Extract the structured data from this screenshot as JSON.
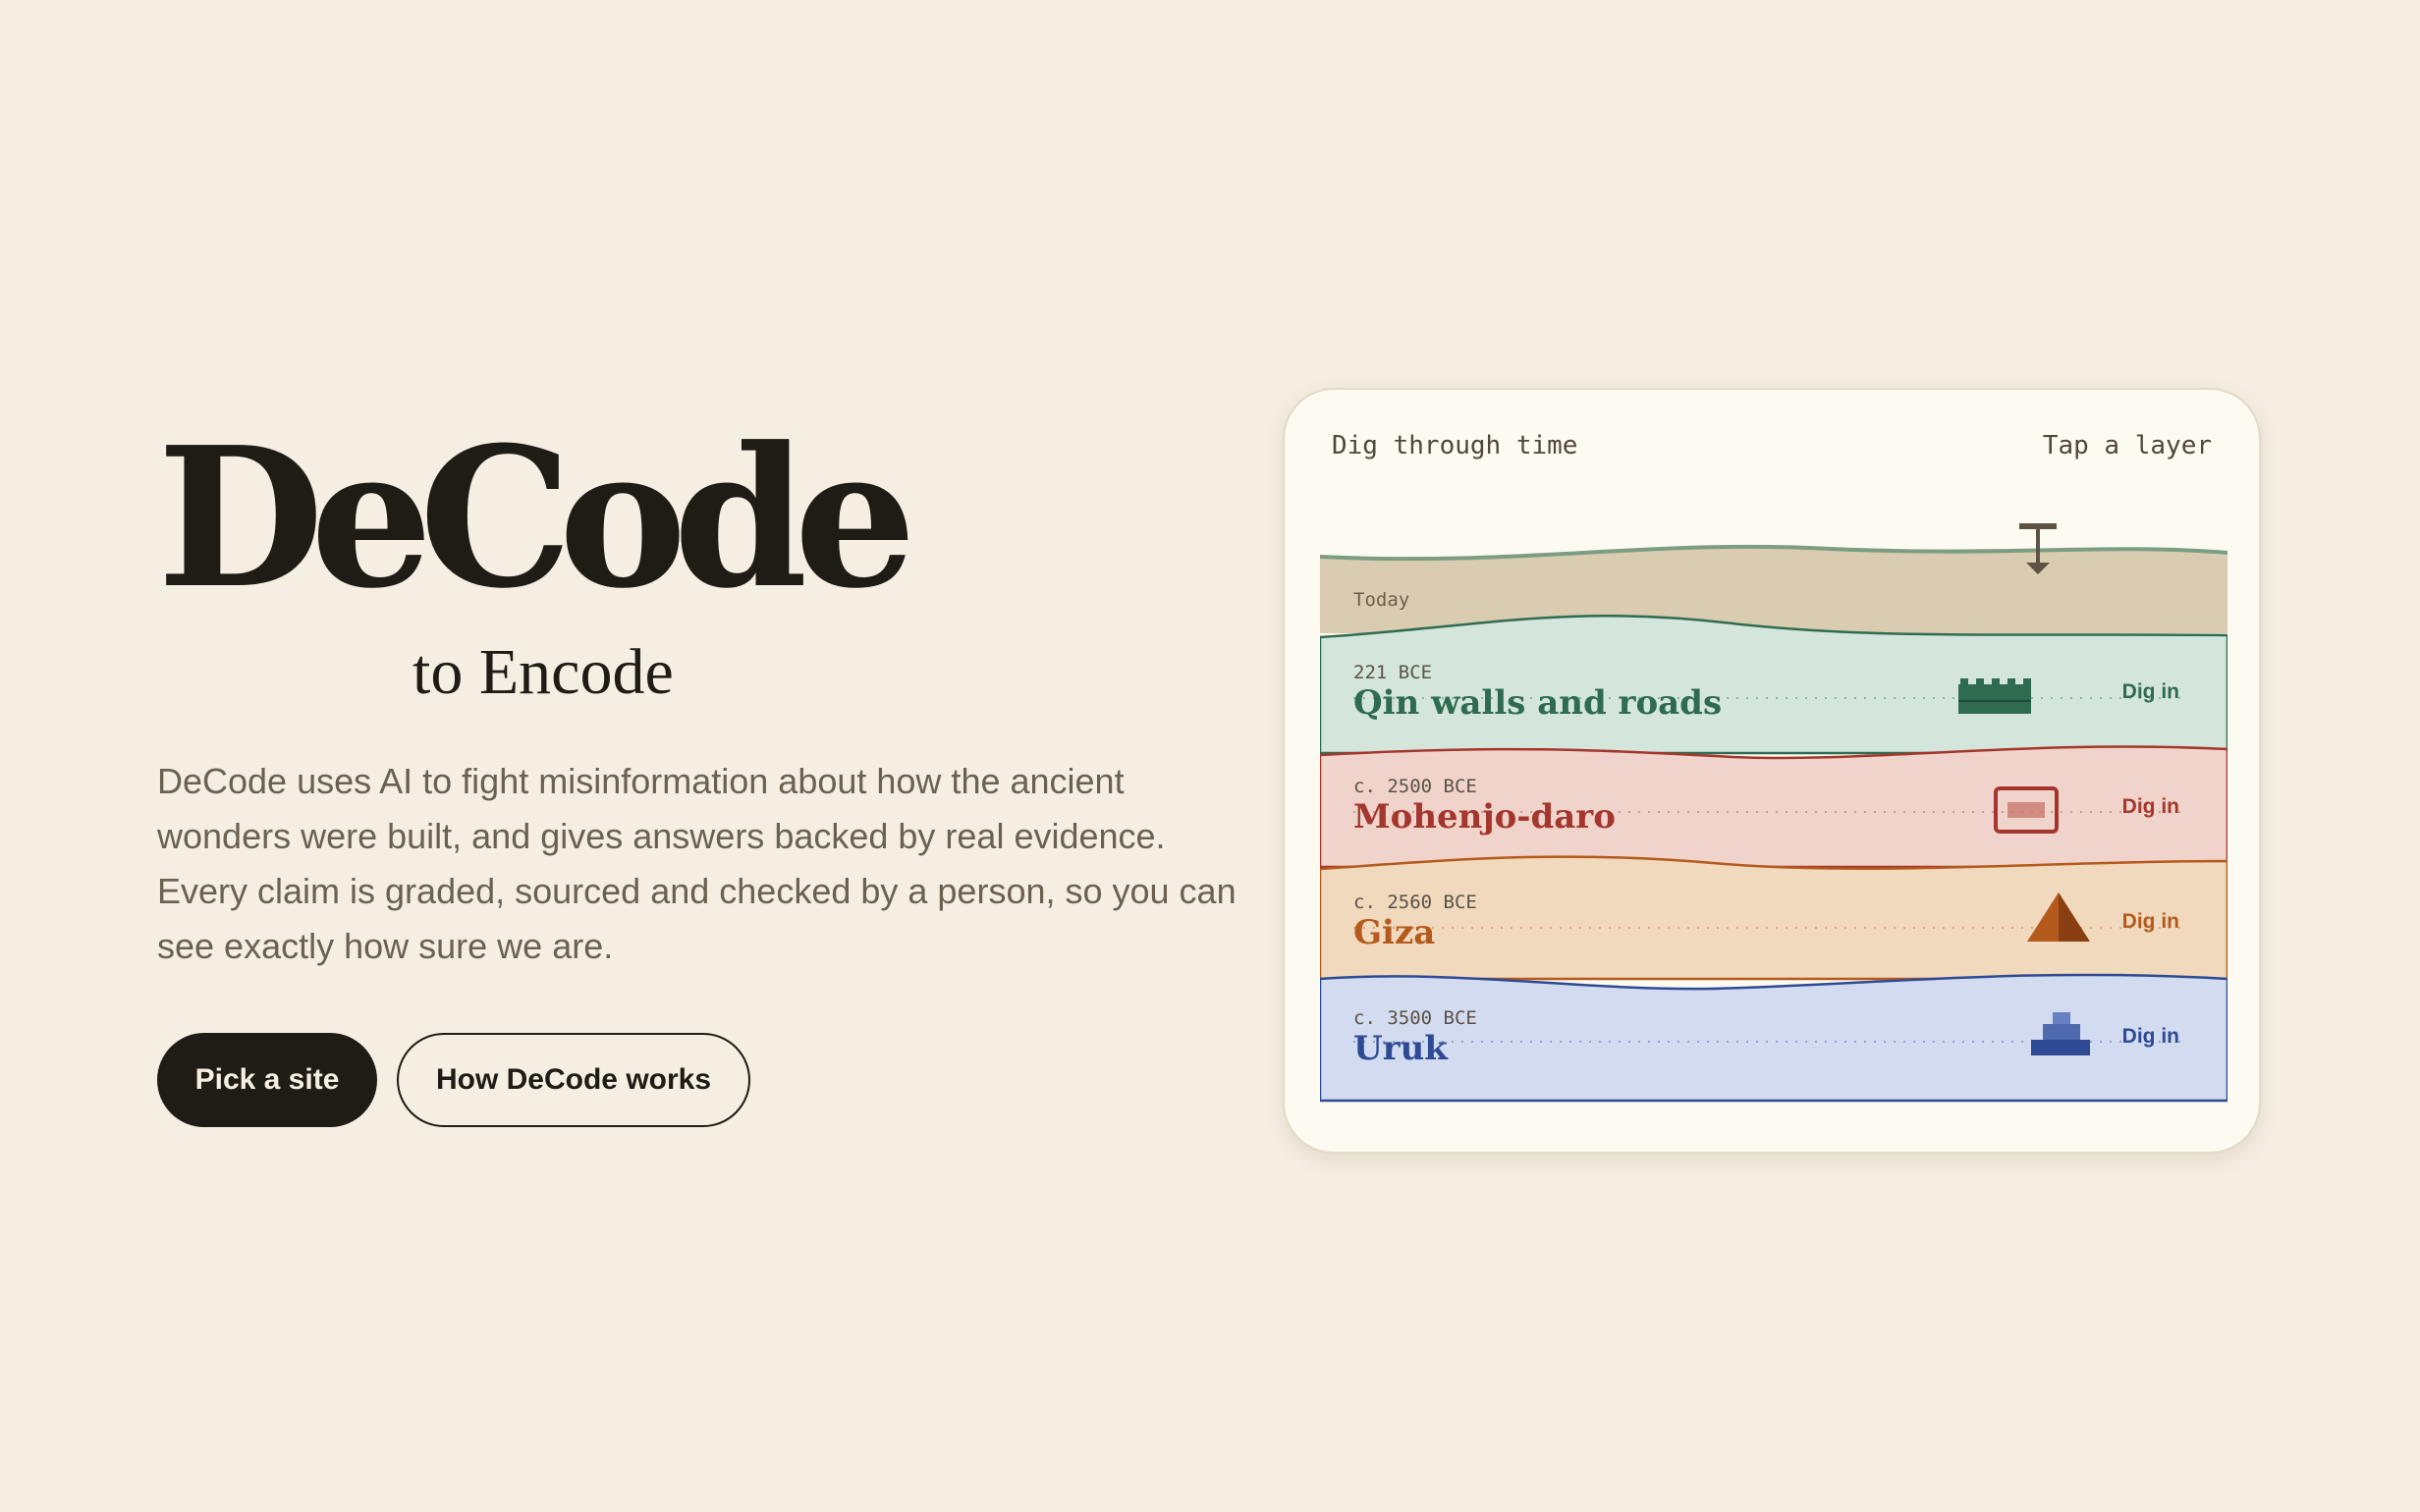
{
  "hero": {
    "title": "DeCode",
    "subtitle": "to Encode",
    "description": "DeCode uses AI to fight misinformation about how the ancient wonders were built, and gives answers backed by real evidence. Every claim is graded, sourced and checked by a person, so you can see exactly how sure we are.",
    "primary_button": "Pick a site",
    "secondary_button": "How DeCode works"
  },
  "card": {
    "header_left": "Dig through time",
    "header_right": "Tap a layer",
    "top_layer_label": "Today",
    "layers": [
      {
        "date": "221 BCE",
        "name": "Qin walls and roads",
        "action": "Dig in",
        "icon": "wall-icon",
        "color": "#2f6b50",
        "fill": "#d4e6dc"
      },
      {
        "date": "c. 2500 BCE",
        "name": "Mohenjo-daro",
        "action": "Dig in",
        "icon": "brick-grid-icon",
        "color": "#a3372d",
        "fill": "#f0d3cb"
      },
      {
        "date": "c. 2560 BCE",
        "name": "Giza",
        "action": "Dig in",
        "icon": "pyramid-icon",
        "color": "#b45a1c",
        "fill": "#f1d9bd"
      },
      {
        "date": "c. 3500 BCE",
        "name": "Uruk",
        "action": "Dig in",
        "icon": "ziggurat-icon",
        "color": "#2e4a94",
        "fill": "#d2dbef"
      }
    ],
    "colors": {
      "surface": "#d9ccb0",
      "grass": "#7c9d83",
      "pickaxe": "#5e5245"
    }
  }
}
